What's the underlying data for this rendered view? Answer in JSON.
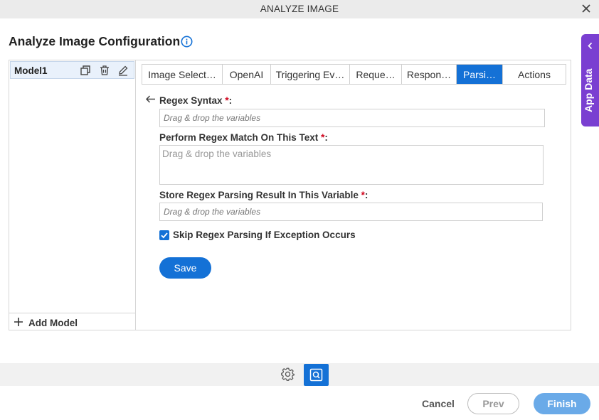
{
  "window": {
    "title": "ANALYZE IMAGE",
    "close_icon": "close-icon"
  },
  "page": {
    "title": "Analyze Image Configuration",
    "info_icon": "info-icon"
  },
  "app_data": {
    "label": "App Data",
    "icon": "chevron-left-icon",
    "color": "#7a3fd1"
  },
  "models": {
    "items": [
      {
        "name": "Model1",
        "icons": [
          "copy-icon",
          "delete-icon",
          "edit-icon"
        ]
      }
    ],
    "add_label": "Add Model"
  },
  "tabs": [
    {
      "label": "Image Select…",
      "active": false
    },
    {
      "label": "OpenAI",
      "active": false
    },
    {
      "label": "Triggering Ev…",
      "active": false
    },
    {
      "label": "Reque…",
      "active": false
    },
    {
      "label": "Respon…",
      "active": false
    },
    {
      "label": "Parsi…",
      "active": true
    },
    {
      "label": "Actions",
      "active": false
    }
  ],
  "form": {
    "regex_syntax": {
      "label": "Regex Syntax",
      "req": "*",
      "colon": ":",
      "placeholder": "Drag & drop the variables"
    },
    "match_text": {
      "label": "Perform Regex Match On This Text",
      "req": "*",
      "colon": ":",
      "placeholder": "Drag & drop the variables"
    },
    "store_result": {
      "label": "Store Regex Parsing Result In This Variable",
      "req": "*",
      "colon": ":",
      "placeholder": "Drag & drop the variables"
    },
    "skip_exception": {
      "label": "Skip Regex Parsing If Exception Occurs",
      "checked": true
    },
    "save_label": "Save"
  },
  "footer": {
    "cancel_label": "Cancel",
    "prev_label": "Prev",
    "finish_label": "Finish"
  },
  "colors": {
    "accent": "#1471d6",
    "finish": "#6aaae8",
    "required": "#d0021b"
  }
}
